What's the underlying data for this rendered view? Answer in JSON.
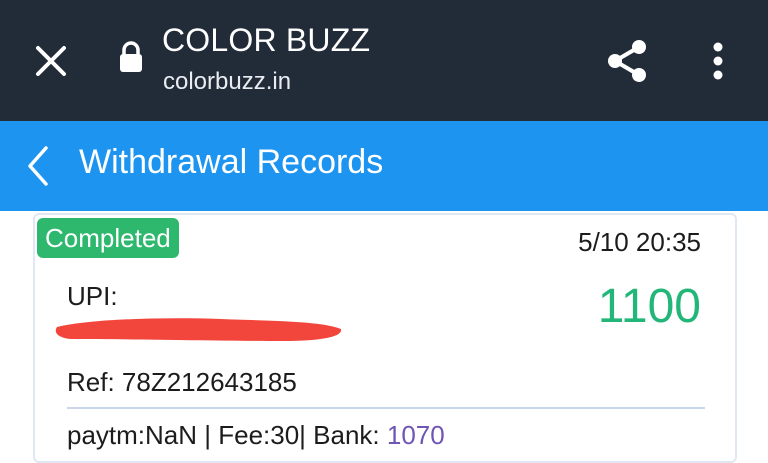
{
  "browser": {
    "title": "COLOR BUZZ",
    "url": "colorbuzz.in",
    "icons": [
      "close-icon",
      "lock-icon",
      "share-icon",
      "more-vert-icon"
    ]
  },
  "header": {
    "title": "Withdrawal Records",
    "back_icon": "chevron-left-icon"
  },
  "record": {
    "status": "Completed",
    "datetime": "5/10 20:35",
    "method": "UPI:",
    "amount": "1100",
    "ref": "Ref: 78Z212643185",
    "footer_prefix": "paytm:NaN | Fee:30| Bank: ",
    "bank_amount": "1070"
  },
  "colors": {
    "browser_bar": "#222b38",
    "header_bar": "#1c94f0",
    "status_badge": "#2eb86e",
    "amount": "#22b779",
    "bank_amount": "#6f55b5",
    "redaction": "#f2463c"
  }
}
